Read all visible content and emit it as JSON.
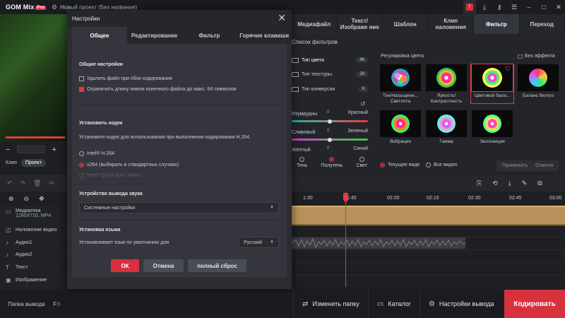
{
  "titlebar": {
    "logo": "GOM Mix",
    "plan": "Pro",
    "project_title": "Новый проект (Без названия)"
  },
  "preview": {
    "mode_clip": "Клип",
    "mode_project": "Проект"
  },
  "tabs": [
    {
      "label": "Медиафайл",
      "active": false
    },
    {
      "label": "Текст/ Изображе ние",
      "active": false
    },
    {
      "label": "Шаблон",
      "active": false
    },
    {
      "label": "Клип наложения",
      "active": false
    },
    {
      "label": "Фильтр",
      "active": true
    },
    {
      "label": "Переход",
      "active": false
    }
  ],
  "filter_panel": {
    "list_title": "Список фильтров",
    "categories": [
      {
        "label": "Тип цвета",
        "count": "86"
      },
      {
        "label": "Тип текстуры",
        "count": "29"
      },
      {
        "label": "Тип конверсии",
        "count": "6"
      }
    ],
    "sliders": [
      {
        "left": "Изумрудны",
        "right": "Красный",
        "value": "0"
      },
      {
        "left": "Сливовый",
        "right": "Зеленый",
        "value": "0"
      },
      {
        "left": "Жёлтый",
        "right": "Синий",
        "value": "0"
      }
    ],
    "tone": {
      "shadow": "Тень",
      "midtone": "Полутень",
      "light": "Свет",
      "selected": "midtone"
    },
    "group_title": "Регулировка цвета",
    "no_effect": "Без эффекта",
    "tiles": [
      {
        "label": "Тон/Насыщенн... Светлота",
        "flower": "fl1"
      },
      {
        "label": "Яркость/ Контрастность",
        "flower": "fl2"
      },
      {
        "label": "Цветовой бала...",
        "flower": "fl3",
        "selected": true
      },
      {
        "label": "Баланс белого",
        "flower": "fl4"
      },
      {
        "label": "Вибрация",
        "flower": "fl5"
      },
      {
        "label": "Гамма",
        "flower": "fl6"
      },
      {
        "label": "Экспозиция",
        "flower": "fl7"
      }
    ],
    "apply_current": "Текущее виде",
    "apply_all": "Все видео",
    "apply_button": "Применить",
    "cancel_button": "Отмена"
  },
  "timeline": {
    "ticks": [
      "1:30",
      "1:45",
      "02:00",
      "02:15",
      "02:30",
      "02:45",
      "03:00"
    ],
    "tracks": [
      {
        "label": "Медиатека",
        "sub1": "1280X720, MP4",
        "icon": "film"
      },
      {
        "label": "Наложение видео",
        "icon": "overlay"
      },
      {
        "label": "Аудио1",
        "icon": "music"
      },
      {
        "label": "Аудио2",
        "icon": "music"
      },
      {
        "label": "Текст",
        "icon": "text"
      },
      {
        "label": "Изображение",
        "icon": "image"
      }
    ]
  },
  "bottom": {
    "output_folder_label": "Папка вывода",
    "output_folder_value": "F:\\",
    "change_folder": "Изменить папку",
    "catalog": "Каталог",
    "output_settings": "Настройки вывода",
    "encode": "Кодировать"
  },
  "dialog": {
    "title": "Настройки",
    "tabs": [
      "Общее",
      "Редактирование",
      "Фильтр",
      "Горячие клавиши"
    ],
    "general_title": "Общие настройки",
    "opt_delete_on_fail": "Удалить файл при сбое кодирования",
    "opt_limit_name": "Ограничить длину имени конечного файла до макс. 64 символов",
    "opt_delete_checked": false,
    "opt_limit_checked": true,
    "codec_title": "Установить кодек",
    "codec_desc": "Установите кодек для использования при выполнении кодирования H.264.",
    "codec_intel": "Intel® H.264",
    "codec_x264": "x264 (выбирать в стандартных случаях)",
    "codec_quicksync": "Intel® Quick Sync Video",
    "audio_title": "Устройство вывода звука",
    "audio_value": "Системные настройки",
    "lang_title": "Установка языка",
    "lang_desc": "Устанавливает язык по умолчанию для",
    "lang_value": "Русский",
    "ok": "ОК",
    "cancel": "Отмена",
    "reset": "полный сброс"
  },
  "colors": {
    "accent": "#e23a45",
    "clip": "#b79159"
  }
}
